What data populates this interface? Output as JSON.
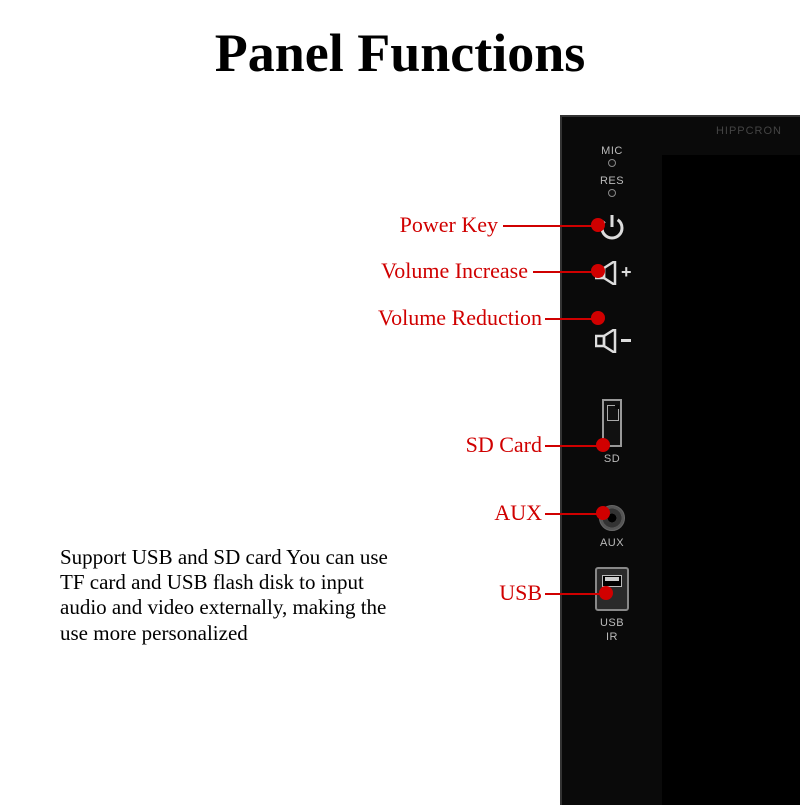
{
  "title": "Panel Functions",
  "brand": "HIPPCRON",
  "panel_labels": {
    "mic": "MIC",
    "res": "RES",
    "sd": "SD",
    "aux": "AUX",
    "usb": "USB",
    "ir": "IR"
  },
  "callouts": {
    "power": "Power Key",
    "vol_up": "Volume Increase",
    "vol_down": "Volume Reduction",
    "sd": "SD Card",
    "aux": "AUX",
    "usb": "USB"
  },
  "description": "Support USB and SD card You can use TF card and USB flash disk to input audio and video externally, making the use more personalized",
  "colors": {
    "callout": "#d00000",
    "device": "#0a0a0a"
  }
}
